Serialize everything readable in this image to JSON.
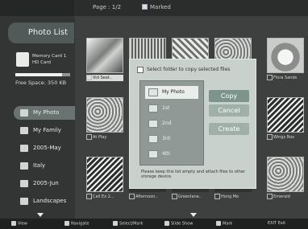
{
  "window": {
    "title": "Photo List"
  },
  "topbar": {
    "filter_label": "Page : 1/2",
    "mode_label": "Marked"
  },
  "memory": {
    "line1": "Memory Card 1",
    "line2": "HD Card",
    "free_space": "Free Space: 350 KB",
    "used_fraction": 0.85
  },
  "folders": [
    {
      "label": "My Photo",
      "selected": true
    },
    {
      "label": "My Family",
      "selected": false
    },
    {
      "label": "2005-May",
      "selected": false
    },
    {
      "label": "Italy",
      "selected": false
    },
    {
      "label": "2005-Jun",
      "selected": false
    },
    {
      "label": "Landscapes",
      "selected": false
    }
  ],
  "thumbs": [
    {
      "caption": "Vid Seat..",
      "highlight": true,
      "icon": "flower"
    },
    {
      "caption": "",
      "highlight": false,
      "icon": "bw"
    },
    {
      "caption": "",
      "highlight": false,
      "icon": "bw"
    },
    {
      "caption": "",
      "highlight": false,
      "icon": "bw"
    },
    {
      "caption": "Flora Sands",
      "highlight": false,
      "icon": "shell"
    },
    {
      "caption": "At Play",
      "highlight": false,
      "icon": "texture"
    },
    {
      "caption": "Wings Box",
      "highlight": false,
      "icon": "lines"
    },
    {
      "caption": "Call Ex 2...",
      "highlight": false,
      "icon": "bird"
    },
    {
      "caption": "Afternoon..",
      "highlight": false,
      "icon": "gray"
    },
    {
      "caption": "Greenlane..",
      "highlight": false,
      "icon": "gray"
    },
    {
      "caption": "Hong Mo",
      "highlight": false,
      "icon": "gray"
    },
    {
      "caption": "Emerald",
      "highlight": false,
      "icon": "gray"
    }
  ],
  "dialog": {
    "prompt": "Select folder to copy selected files",
    "folders": [
      {
        "label": "My Photo",
        "selected": true
      },
      {
        "label": "1st",
        "selected": false
      },
      {
        "label": "2nd",
        "selected": false
      },
      {
        "label": "3rd",
        "selected": false
      },
      {
        "label": "4th",
        "selected": false
      }
    ],
    "buttons": {
      "copy": "Copy",
      "cancel": "Cancel",
      "create": "Create"
    },
    "note": "Please keep this list empty and attach files to other storage device."
  },
  "footer": [
    {
      "key": "ENTER",
      "label": "View"
    },
    {
      "key": "move",
      "label": "Navigate"
    },
    {
      "key": "mark",
      "label": "Select/Mark"
    },
    {
      "key": "yellow",
      "label": "Slide Show"
    },
    {
      "key": "tools",
      "label": "Mark"
    },
    {
      "key": "back",
      "label": "EXIT Exit"
    }
  ]
}
